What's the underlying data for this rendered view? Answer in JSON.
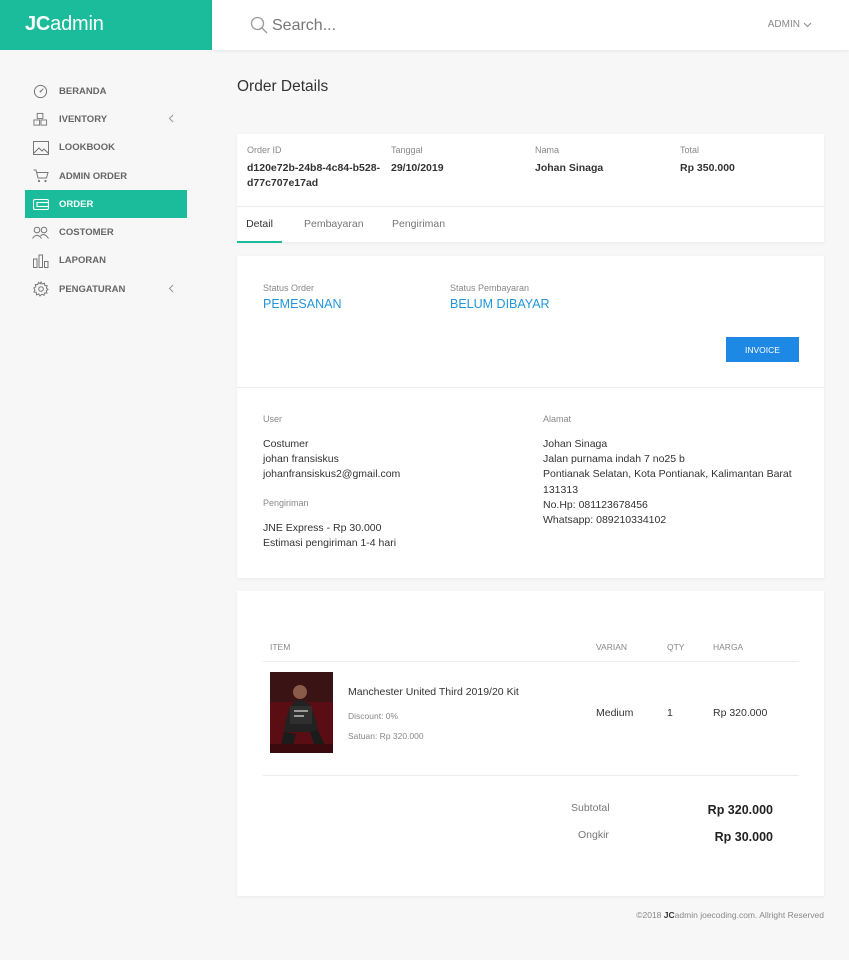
{
  "brand": {
    "prefix": "JC",
    "suffix": "admin"
  },
  "search": {
    "placeholder": "Search..."
  },
  "user_menu": {
    "label": "ADMIN"
  },
  "sidebar": {
    "items": [
      {
        "label": "BERANDA",
        "icon": "dashboard-icon"
      },
      {
        "label": "IVENTORY",
        "icon": "cubes-icon"
      },
      {
        "label": "LOOKBOOK",
        "icon": "image-icon"
      },
      {
        "label": "ADMIN ORDER",
        "icon": "cart-icon"
      },
      {
        "label": "ORDER",
        "icon": "wallet-icon",
        "active": true
      },
      {
        "label": "COSTOMER",
        "icon": "users-icon"
      },
      {
        "label": "LAPORAN",
        "icon": "bar-chart-icon"
      },
      {
        "label": "PENGATURAN",
        "icon": "gear-icon"
      }
    ]
  },
  "page": {
    "title": "Order Details"
  },
  "summary": {
    "order_id_label": "Order ID",
    "order_id_line1": "d120e72b-24b8-4c84-b528-",
    "order_id_line2": "d77c707e17ad",
    "date_label": "Tanggal",
    "date": "29/10/2019",
    "name_label": "Nama",
    "name": "Johan Sinaga",
    "total_label": "Total",
    "total": "Rp 350.000"
  },
  "tabs": [
    "Detail",
    "Pembayaran",
    "Pengiriman"
  ],
  "status": {
    "order_label": "Status Order",
    "order_value": "PEMESANAN",
    "payment_label": "Status Pembayaran",
    "payment_value": "BELUM DIBAYAR",
    "invoice_button": "INVOICE"
  },
  "user_info": {
    "label": "User",
    "role": "Costumer",
    "name": "johan fransiskus",
    "email": "johanfransiskus2@gmail.com"
  },
  "shipping": {
    "label": "Pengiriman",
    "method": "JNE Express - Rp 30.000",
    "estimate": "Estimasi pengiriman 1-4 hari"
  },
  "address": {
    "label": "Alamat",
    "name": "Johan Sinaga",
    "street": "Jalan purnama indah 7 no25 b",
    "city": "Pontianak Selatan, Kota Pontianak, Kalimantan Barat",
    "postal": "131313",
    "phone": "No.Hp: 081123678456",
    "whatsapp": "Whatsapp: 089210334102"
  },
  "items_table": {
    "headers": [
      "ITEM",
      "VARIAN",
      "QTY",
      "HARGA"
    ],
    "rows": [
      {
        "name": "Manchester United Third 2019/20 Kit",
        "discount": "Discount: 0%",
        "unit_price": "Satuan: Rp 320.000",
        "variant": "Medium",
        "qty": "1",
        "price": "Rp 320.000"
      }
    ]
  },
  "totals": {
    "subtotal_label": "Subtotal",
    "subtotal": "Rp 320.000",
    "shipping_label": "Ongkir",
    "shipping": "Rp 30.000"
  },
  "footer": {
    "prefix": "©2018",
    "brand_bold": "JC",
    "brand_rest": "admin",
    "suffix": "joecoding.com. Allright Reserved"
  },
  "colors": {
    "brand": "#1bbc9b",
    "link": "#2196d9",
    "button": "#1e88e5"
  }
}
